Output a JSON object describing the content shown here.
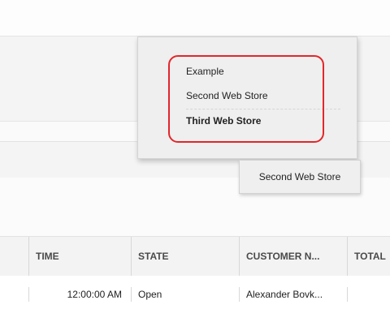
{
  "store_dropdown": {
    "options": [
      "Example",
      "Second Web Store",
      "Third Web Store"
    ],
    "selected_index": 2,
    "highlight_color": "#e3262b"
  },
  "store_button": {
    "label": "Second Web Store"
  },
  "grid": {
    "columns": [
      "TIME",
      "STATE",
      "CUSTOMER N...",
      "TOTAL"
    ],
    "rows": [
      {
        "time": "12:00:00 AM",
        "state": "Open",
        "customer": "Alexander Bovk..."
      }
    ]
  }
}
